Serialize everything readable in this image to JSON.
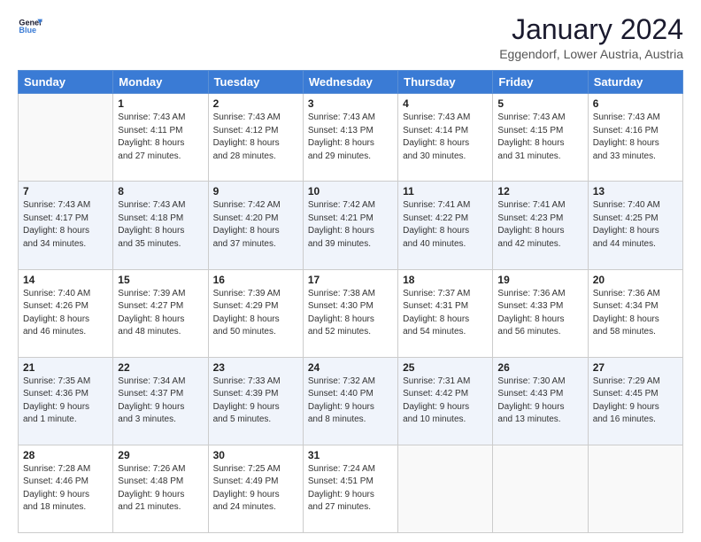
{
  "header": {
    "logo_general": "General",
    "logo_blue": "Blue",
    "title": "January 2024",
    "subtitle": "Eggendorf, Lower Austria, Austria"
  },
  "columns": [
    "Sunday",
    "Monday",
    "Tuesday",
    "Wednesday",
    "Thursday",
    "Friday",
    "Saturday"
  ],
  "weeks": [
    [
      {
        "num": "",
        "info": ""
      },
      {
        "num": "1",
        "info": "Sunrise: 7:43 AM\nSunset: 4:11 PM\nDaylight: 8 hours\nand 27 minutes."
      },
      {
        "num": "2",
        "info": "Sunrise: 7:43 AM\nSunset: 4:12 PM\nDaylight: 8 hours\nand 28 minutes."
      },
      {
        "num": "3",
        "info": "Sunrise: 7:43 AM\nSunset: 4:13 PM\nDaylight: 8 hours\nand 29 minutes."
      },
      {
        "num": "4",
        "info": "Sunrise: 7:43 AM\nSunset: 4:14 PM\nDaylight: 8 hours\nand 30 minutes."
      },
      {
        "num": "5",
        "info": "Sunrise: 7:43 AM\nSunset: 4:15 PM\nDaylight: 8 hours\nand 31 minutes."
      },
      {
        "num": "6",
        "info": "Sunrise: 7:43 AM\nSunset: 4:16 PM\nDaylight: 8 hours\nand 33 minutes."
      }
    ],
    [
      {
        "num": "7",
        "info": "Sunrise: 7:43 AM\nSunset: 4:17 PM\nDaylight: 8 hours\nand 34 minutes."
      },
      {
        "num": "8",
        "info": "Sunrise: 7:43 AM\nSunset: 4:18 PM\nDaylight: 8 hours\nand 35 minutes."
      },
      {
        "num": "9",
        "info": "Sunrise: 7:42 AM\nSunset: 4:20 PM\nDaylight: 8 hours\nand 37 minutes."
      },
      {
        "num": "10",
        "info": "Sunrise: 7:42 AM\nSunset: 4:21 PM\nDaylight: 8 hours\nand 39 minutes."
      },
      {
        "num": "11",
        "info": "Sunrise: 7:41 AM\nSunset: 4:22 PM\nDaylight: 8 hours\nand 40 minutes."
      },
      {
        "num": "12",
        "info": "Sunrise: 7:41 AM\nSunset: 4:23 PM\nDaylight: 8 hours\nand 42 minutes."
      },
      {
        "num": "13",
        "info": "Sunrise: 7:40 AM\nSunset: 4:25 PM\nDaylight: 8 hours\nand 44 minutes."
      }
    ],
    [
      {
        "num": "14",
        "info": "Sunrise: 7:40 AM\nSunset: 4:26 PM\nDaylight: 8 hours\nand 46 minutes."
      },
      {
        "num": "15",
        "info": "Sunrise: 7:39 AM\nSunset: 4:27 PM\nDaylight: 8 hours\nand 48 minutes."
      },
      {
        "num": "16",
        "info": "Sunrise: 7:39 AM\nSunset: 4:29 PM\nDaylight: 8 hours\nand 50 minutes."
      },
      {
        "num": "17",
        "info": "Sunrise: 7:38 AM\nSunset: 4:30 PM\nDaylight: 8 hours\nand 52 minutes."
      },
      {
        "num": "18",
        "info": "Sunrise: 7:37 AM\nSunset: 4:31 PM\nDaylight: 8 hours\nand 54 minutes."
      },
      {
        "num": "19",
        "info": "Sunrise: 7:36 AM\nSunset: 4:33 PM\nDaylight: 8 hours\nand 56 minutes."
      },
      {
        "num": "20",
        "info": "Sunrise: 7:36 AM\nSunset: 4:34 PM\nDaylight: 8 hours\nand 58 minutes."
      }
    ],
    [
      {
        "num": "21",
        "info": "Sunrise: 7:35 AM\nSunset: 4:36 PM\nDaylight: 9 hours\nand 1 minute."
      },
      {
        "num": "22",
        "info": "Sunrise: 7:34 AM\nSunset: 4:37 PM\nDaylight: 9 hours\nand 3 minutes."
      },
      {
        "num": "23",
        "info": "Sunrise: 7:33 AM\nSunset: 4:39 PM\nDaylight: 9 hours\nand 5 minutes."
      },
      {
        "num": "24",
        "info": "Sunrise: 7:32 AM\nSunset: 4:40 PM\nDaylight: 9 hours\nand 8 minutes."
      },
      {
        "num": "25",
        "info": "Sunrise: 7:31 AM\nSunset: 4:42 PM\nDaylight: 9 hours\nand 10 minutes."
      },
      {
        "num": "26",
        "info": "Sunrise: 7:30 AM\nSunset: 4:43 PM\nDaylight: 9 hours\nand 13 minutes."
      },
      {
        "num": "27",
        "info": "Sunrise: 7:29 AM\nSunset: 4:45 PM\nDaylight: 9 hours\nand 16 minutes."
      }
    ],
    [
      {
        "num": "28",
        "info": "Sunrise: 7:28 AM\nSunset: 4:46 PM\nDaylight: 9 hours\nand 18 minutes."
      },
      {
        "num": "29",
        "info": "Sunrise: 7:26 AM\nSunset: 4:48 PM\nDaylight: 9 hours\nand 21 minutes."
      },
      {
        "num": "30",
        "info": "Sunrise: 7:25 AM\nSunset: 4:49 PM\nDaylight: 9 hours\nand 24 minutes."
      },
      {
        "num": "31",
        "info": "Sunrise: 7:24 AM\nSunset: 4:51 PM\nDaylight: 9 hours\nand 27 minutes."
      },
      {
        "num": "",
        "info": ""
      },
      {
        "num": "",
        "info": ""
      },
      {
        "num": "",
        "info": ""
      }
    ]
  ]
}
